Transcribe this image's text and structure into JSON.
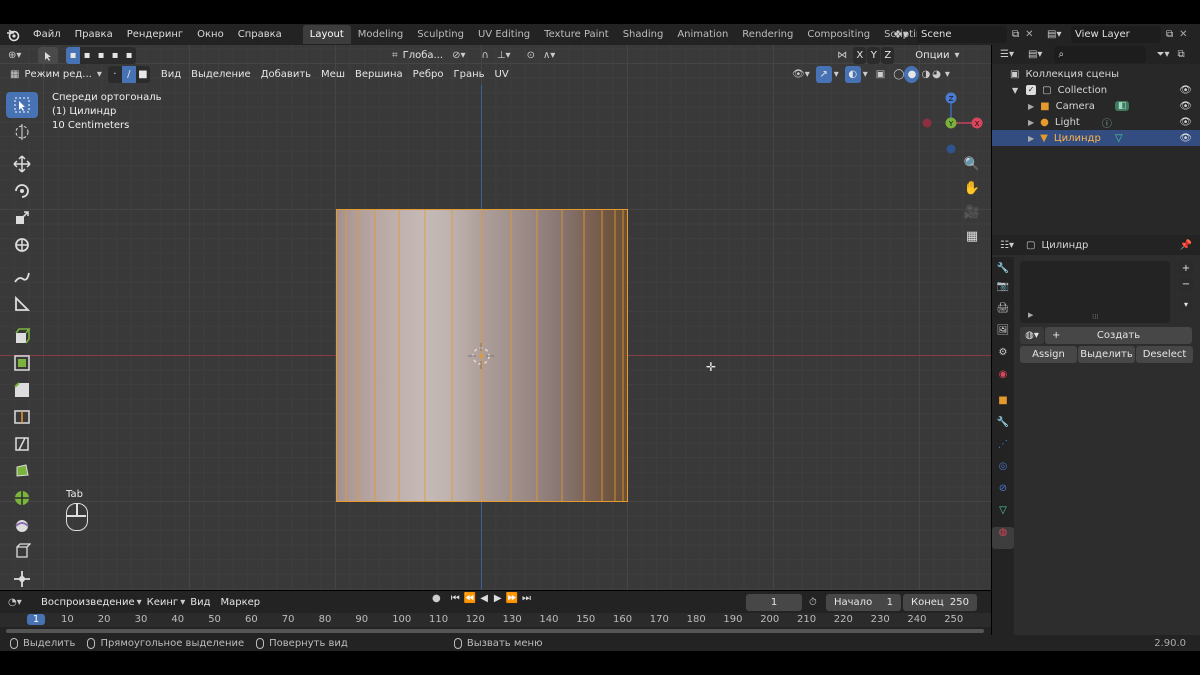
{
  "menu": {
    "items": [
      "Файл",
      "Правка",
      "Рендеринг",
      "Окно",
      "Справка"
    ]
  },
  "workspaces": {
    "tabs": [
      "Layout",
      "Modeling",
      "Sculpting",
      "UV Editing",
      "Texture Paint",
      "Shading",
      "Animation",
      "Rendering",
      "Compositing",
      "Scripting"
    ],
    "active": "Layout",
    "add_label": "+"
  },
  "scene": {
    "name": "Scene"
  },
  "view_layer": {
    "name": "View Layer"
  },
  "header2": {
    "transform_orientation": "Глоба...",
    "axis_x": "X",
    "axis_y": "Y",
    "axis_z": "Z",
    "options": "Опции"
  },
  "viewport_header": {
    "mode": "Режим ред...",
    "menus": [
      "Вид",
      "Выделение",
      "Добавить",
      "Меш",
      "Вершина",
      "Ребро",
      "Грань",
      "UV"
    ]
  },
  "viewport_info": {
    "view_name": "Спереди ортогональ",
    "object": "(1) Цилиндр",
    "scale": "10 Centimeters"
  },
  "gizmo": {
    "z": "Z",
    "y": "Y",
    "x": "X"
  },
  "keyhint": {
    "label": "Tab"
  },
  "outliner": {
    "title": "Коллекция сцены",
    "collection": "Collection",
    "items": [
      "Camera",
      "Light",
      "Цилиндр"
    ],
    "selected": "Цилиндр"
  },
  "properties": {
    "object_name": "Цилиндр",
    "new_label": "Создать",
    "assign": "Assign",
    "select": "Выделить",
    "deselect": "Deselect"
  },
  "timeline": {
    "menus": [
      "Воспроизведение",
      "Кеинг",
      "Вид",
      "Маркер"
    ],
    "current_frame": "1",
    "start_label": "Начало",
    "start_value": "1",
    "end_label": "Конец",
    "end_value": "250",
    "ruler": [
      "1",
      "10",
      "20",
      "30",
      "40",
      "50",
      "60",
      "70",
      "80",
      "90",
      "100",
      "110",
      "120",
      "130",
      "140",
      "150",
      "160",
      "170",
      "180",
      "190",
      "200",
      "210",
      "220",
      "230",
      "240",
      "250"
    ]
  },
  "statusbar": {
    "select": "Выделить",
    "box_select": "Прямоугольное выделение",
    "rotate_view": "Повернуть вид",
    "call_menu": "Вызвать меню",
    "version": "2.90.0"
  },
  "colors": {
    "accent": "#4772b3",
    "selected_orange": "#e59a2e",
    "axis_red": "#a8444f",
    "axis_blue": "#3a6ab4"
  }
}
